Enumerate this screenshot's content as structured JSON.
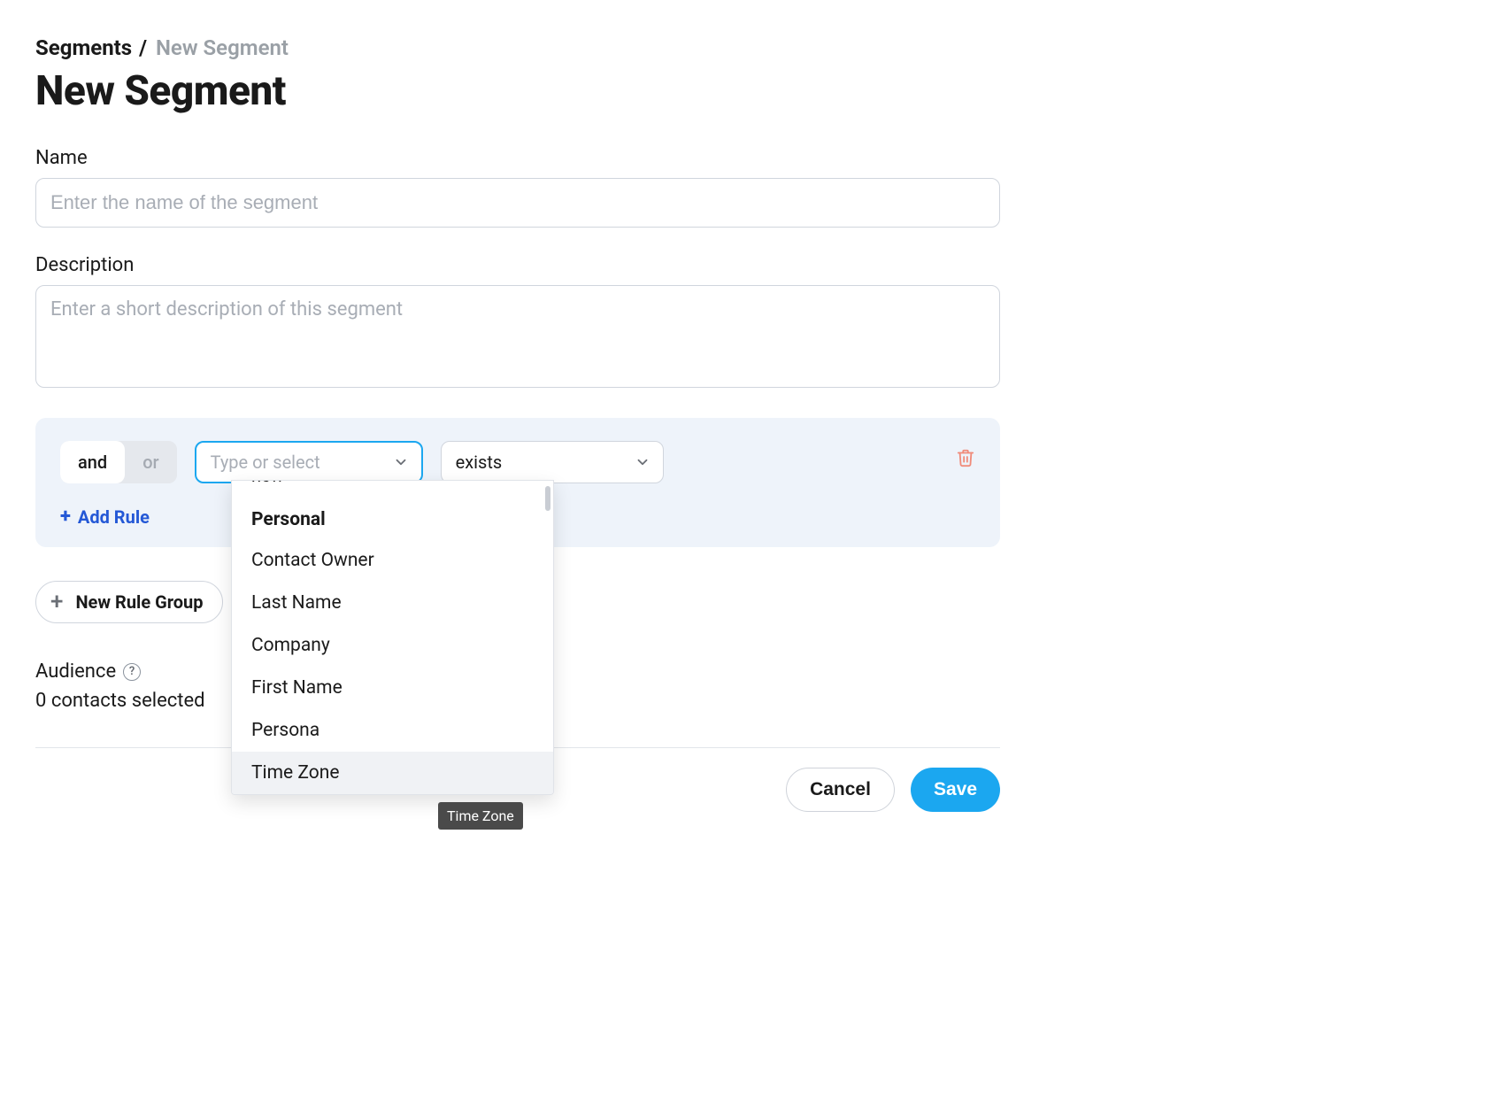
{
  "breadcrumb": {
    "root": "Segments",
    "sep": "/",
    "current": "New Segment"
  },
  "page_title": "New Segment",
  "fields": {
    "name": {
      "label": "Name",
      "placeholder": "Enter the name of the segment",
      "value": ""
    },
    "description": {
      "label": "Description",
      "placeholder": "Enter a short description of this segment",
      "value": ""
    }
  },
  "rule": {
    "logic": {
      "and": "and",
      "or": "or",
      "active": "and"
    },
    "type_select": {
      "placeholder": "Type or select"
    },
    "condition_select": {
      "value": "exists"
    },
    "add_rule_label": "Add Rule"
  },
  "dropdown": {
    "partial_top": "new",
    "group_label": "Personal",
    "options": [
      "Contact Owner",
      "Last Name",
      "Company",
      "First Name",
      "Persona",
      "Time Zone"
    ],
    "hover_index": 5
  },
  "tooltip": "Time Zone",
  "new_rule_group_label": "New Rule Group",
  "audience": {
    "label": "Audience",
    "help": "?",
    "count_text": "0 contacts selected"
  },
  "actions": {
    "cancel": "Cancel",
    "save": "Save"
  },
  "colors": {
    "accent_blue": "#1ba7f0",
    "link_blue": "#2458d6",
    "panel_bg": "#eef3fa",
    "trash": "#f08b7a"
  }
}
